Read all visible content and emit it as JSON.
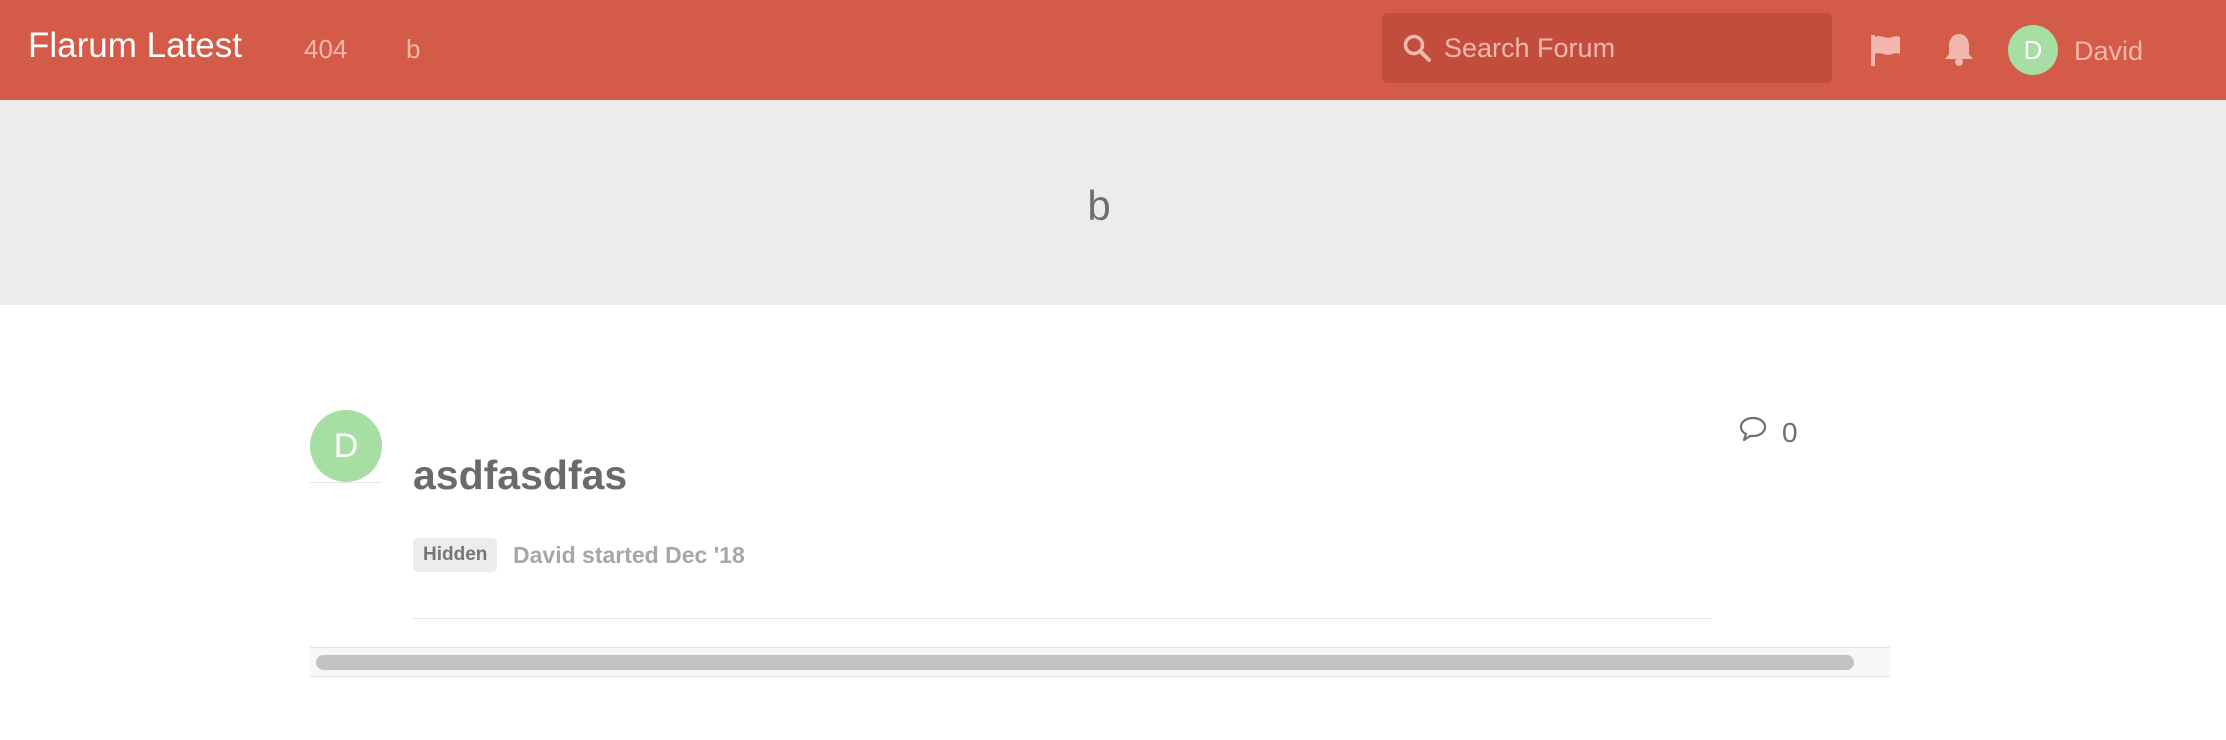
{
  "header": {
    "brand": "Flarum Latest",
    "nav_links": [
      "404",
      "b"
    ],
    "search": {
      "placeholder": "Search Forum",
      "icon": "search-icon"
    },
    "icons": [
      "flag-icon",
      "bell-icon"
    ],
    "user": {
      "avatar_initial": "D",
      "name": "David"
    }
  },
  "hero": {
    "title": "b"
  },
  "discussion": {
    "avatar_initial": "D",
    "title": "asdfasdfas",
    "badge": "Hidden",
    "meta": "David started Dec '18",
    "reply_count": "0",
    "reply_icon": "comment-icon"
  },
  "colors": {
    "header_bg": "#d45b48",
    "search_bg": "#c24d3c",
    "avatar_bg": "#a6dea3",
    "hero_bg": "#ececec"
  }
}
